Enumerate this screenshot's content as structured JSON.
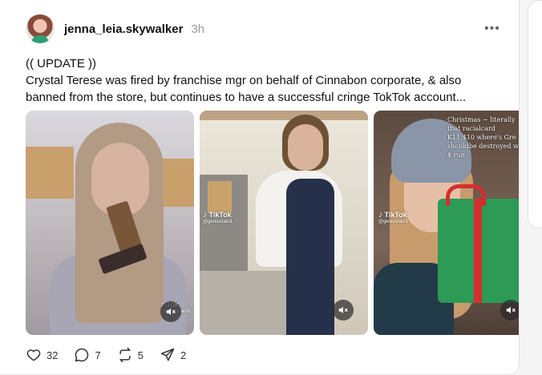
{
  "post": {
    "username": "jenna_leia.skywalker",
    "timestamp": "3h",
    "more_icon": "ellipsis-icon",
    "body_line1": "(( UPDATE ))",
    "body_line2": "Crystal Terese was fired by franchise mgr on behalf of Cinnabon corporate, & also",
    "body_line3": "banned from the store, but continues to have a successful cringe TokTok account...",
    "media": [
      {
        "tiktok_label": "Tok",
        "tiktok_handle": "@geniusrain1",
        "icons": [
          "tiktok-logo-icon",
          "mute-icon"
        ]
      },
      {
        "tiktok_label": "TikTok",
        "tiktok_handle": "@geniusrain1",
        "icons": [
          "tiktok-logo-icon",
          "mute-icon"
        ]
      },
      {
        "tiktok_label": "TikTok",
        "tiktok_handle": "@geniusrain1",
        "overlay_line1": "Christmas ~ literally",
        "overlay_line2": "that racialcard",
        "overlay_line3": "K11.$10 where's Gre",
        "overlay_line4": "shouldbe destroyed w",
        "overlay_line5": "$ run",
        "icons": [
          "tiktok-logo-icon",
          "mute-icon"
        ]
      }
    ]
  },
  "actions": {
    "likes": "32",
    "comments": "7",
    "reposts": "5",
    "shares": "2",
    "icons": [
      "heart-icon",
      "comment-icon",
      "repost-icon",
      "share-icon"
    ]
  },
  "colors": {
    "background": "#f5f5f5",
    "card": "#ffffff",
    "text": "#111111",
    "muted": "#9a9a9a"
  }
}
